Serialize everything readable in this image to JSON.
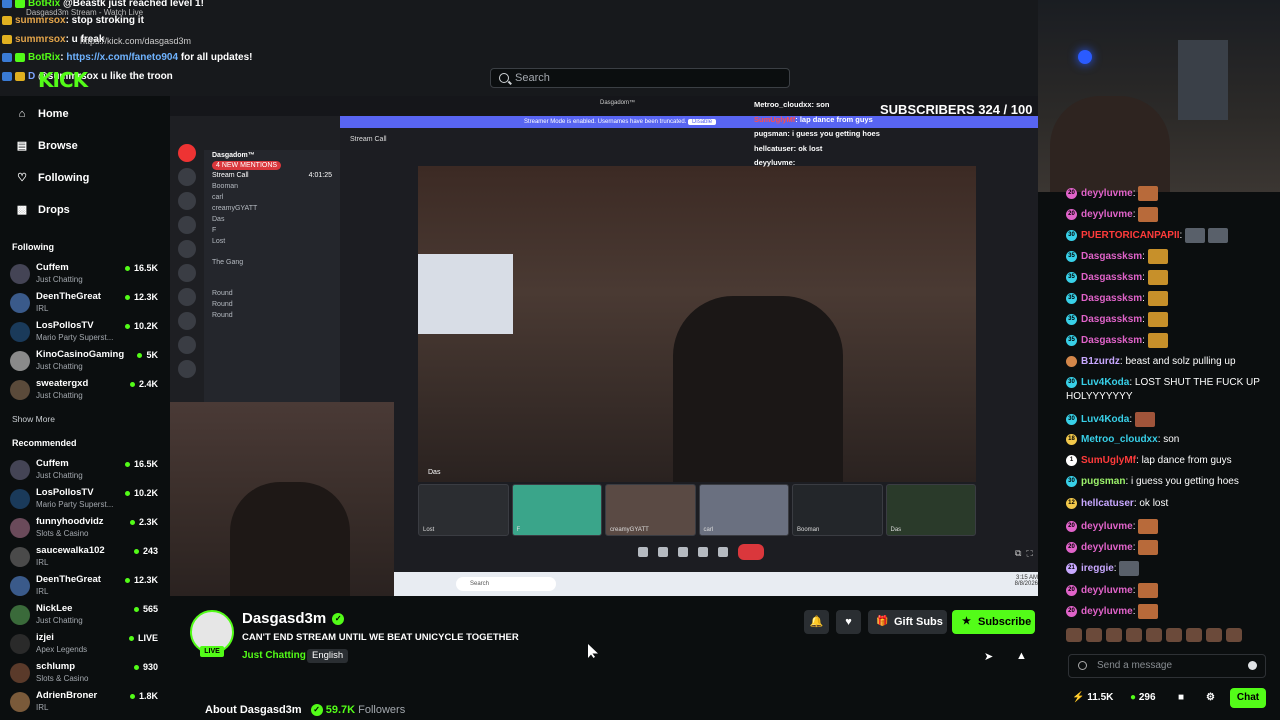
{
  "overlay_top": {
    "lines": [
      {
        "user": "BotRix",
        "message": "@Beastk just reached level 1!"
      },
      {
        "user": "summrsox",
        "message": ": stop stroking it"
      },
      {
        "user": "summrsox",
        "message": ": u freak"
      },
      {
        "user": "BotRix",
        "message": "https://x.com/faneto904",
        "suffix": " for all updates!"
      },
      {
        "user": "D",
        "message": "@summrsox u like the troon"
      }
    ],
    "browser_tab": "Dasgasd3m Stream - Watch Live",
    "url": "https://kick.com/dasgasd3m",
    "logo": "KICK"
  },
  "search": {
    "placeholder": "Search"
  },
  "nav": {
    "home": "Home",
    "browse": "Browse",
    "following": "Following",
    "drops": "Drops"
  },
  "following": {
    "heading": "Following",
    "channels": [
      {
        "name": "Cuffem",
        "category": "Just Chatting",
        "viewers": "16.5K"
      },
      {
        "name": "DeenTheGreat",
        "category": "IRL",
        "viewers": "12.3K"
      },
      {
        "name": "LosPollosTV",
        "category": "Mario Party Superst...",
        "viewers": "10.2K"
      },
      {
        "name": "KinoCasinoGaming",
        "category": "Just Chatting",
        "viewers": "5K"
      },
      {
        "name": "sweatergxd",
        "category": "Just Chatting",
        "viewers": "2.4K"
      }
    ],
    "show_more": "Show More"
  },
  "recommended": {
    "heading": "Recommended",
    "channels": [
      {
        "name": "Cuffem",
        "category": "Just Chatting",
        "viewers": "16.5K"
      },
      {
        "name": "LosPollosTV",
        "category": "Mario Party Superst...",
        "viewers": "10.2K"
      },
      {
        "name": "funnyhoodvidz",
        "category": "Slots & Casino",
        "viewers": "2.3K"
      },
      {
        "name": "saucewalka102",
        "category": "IRL",
        "viewers": "243"
      },
      {
        "name": "DeenTheGreat",
        "category": "IRL",
        "viewers": "12.3K"
      },
      {
        "name": "NickLee",
        "category": "Just Chatting",
        "viewers": "565"
      },
      {
        "name": "izjei",
        "category": "Apex Legends",
        "viewers": "LIVE"
      },
      {
        "name": "schlump",
        "category": "Slots & Casino",
        "viewers": "930"
      },
      {
        "name": "AdrienBroner",
        "category": "IRL",
        "viewers": "1.8K"
      }
    ]
  },
  "video": {
    "subscribers_overlay": "SUBSCRIBERS 324 / 100",
    "streamer_mode": "Streamer Mode is enabled. Usernames have been truncated.",
    "disable": "Disable",
    "server_name": "Dasgadom™",
    "mentions": "4 NEW MENTIONS",
    "stream_call": "Stream Call",
    "call_time": "4:01:25",
    "voice_users": [
      "Booman",
      "carl",
      "creamyGYATT",
      "Das",
      "F",
      "Lost"
    ],
    "the_gang": "The Gang",
    "rounds": [
      "Round",
      "Round",
      "Round"
    ],
    "call_label": "Das",
    "thumbs": [
      "Lost",
      "F",
      "creamyGYATT",
      "carl",
      "Booman",
      "Das"
    ],
    "taskbar_search": "Search",
    "clock": "3:15 AM",
    "date": "8/8/2026",
    "overlay_chat": [
      {
        "user": "Metroo_cloudxx",
        "message": "son"
      },
      {
        "user": "SumUglyMf",
        "message": "lap dance from guys"
      },
      {
        "user": "pugsman",
        "message": "i guess you getting hoes"
      },
      {
        "user": "hellcatuser",
        "message": "ok lost"
      },
      {
        "user": "deyyluvme",
        "message": ""
      }
    ]
  },
  "channel": {
    "name": "Dasgasd3m",
    "live": "LIVE",
    "title": "CAN'T END STREAM UNTIL WE BEAT UNICYCLE TOGETHER",
    "category": "Just Chatting",
    "tag": "English",
    "gift": "Gift Subs",
    "subscribe": "Subscribe",
    "about_prefix": "About Dasgasd3m",
    "followers_count": "59.7K",
    "followers_label": "Followers"
  },
  "chat": {
    "messages": [
      {
        "user": "deyyluvme",
        "message": "",
        "color": "pink"
      },
      {
        "user": "deyyluvme",
        "message": "",
        "color": "pink"
      },
      {
        "user": "PUERTORICANPAPII",
        "message": "",
        "color": "red"
      },
      {
        "user": "Dasgassksm",
        "message": "",
        "color": "pink"
      },
      {
        "user": "Dasgassksm",
        "message": "",
        "color": "pink"
      },
      {
        "user": "Dasgassksm",
        "message": "",
        "color": "pink"
      },
      {
        "user": "Dasgassksm",
        "message": "",
        "color": "pink"
      },
      {
        "user": "Dasgassksm",
        "message": "",
        "color": "pink"
      },
      {
        "user": "B1zurdz",
        "message": "beast and solz pulling up",
        "color": "lilac"
      },
      {
        "user": "Luv4Koda",
        "message": "LOST SHUT THE FUCK UP",
        "cont": "HOLYYYYYYY",
        "color": "teal"
      },
      {
        "user": "Luv4Koda",
        "message": "",
        "color": "teal"
      },
      {
        "user": "Metroo_cloudxx",
        "message": "son",
        "color": "teal"
      },
      {
        "user": "SumUglyMf",
        "message": "lap dance from guys",
        "color": "red"
      },
      {
        "user": "pugsman",
        "message": "i guess you getting hoes",
        "color": "lgreen"
      },
      {
        "user": "hellcatuser",
        "message": "ok lost",
        "color": "lilac"
      },
      {
        "user": "deyyluvme",
        "message": "",
        "color": "pink"
      },
      {
        "user": "deyyluvme",
        "message": "",
        "color": "pink"
      },
      {
        "user": "ireggie",
        "message": "",
        "color": "lilac"
      },
      {
        "user": "deyyluvme",
        "message": "",
        "color": "pink"
      },
      {
        "user": "deyyluvme",
        "message": "",
        "color": "pink"
      }
    ],
    "placeholder": "Send a message",
    "kicks": "11.5K",
    "points": "296",
    "chat_button": "Chat"
  },
  "colors": {
    "accent": "#53fc18",
    "bg": "#0b0e0f",
    "panel": "#2a2e32"
  }
}
